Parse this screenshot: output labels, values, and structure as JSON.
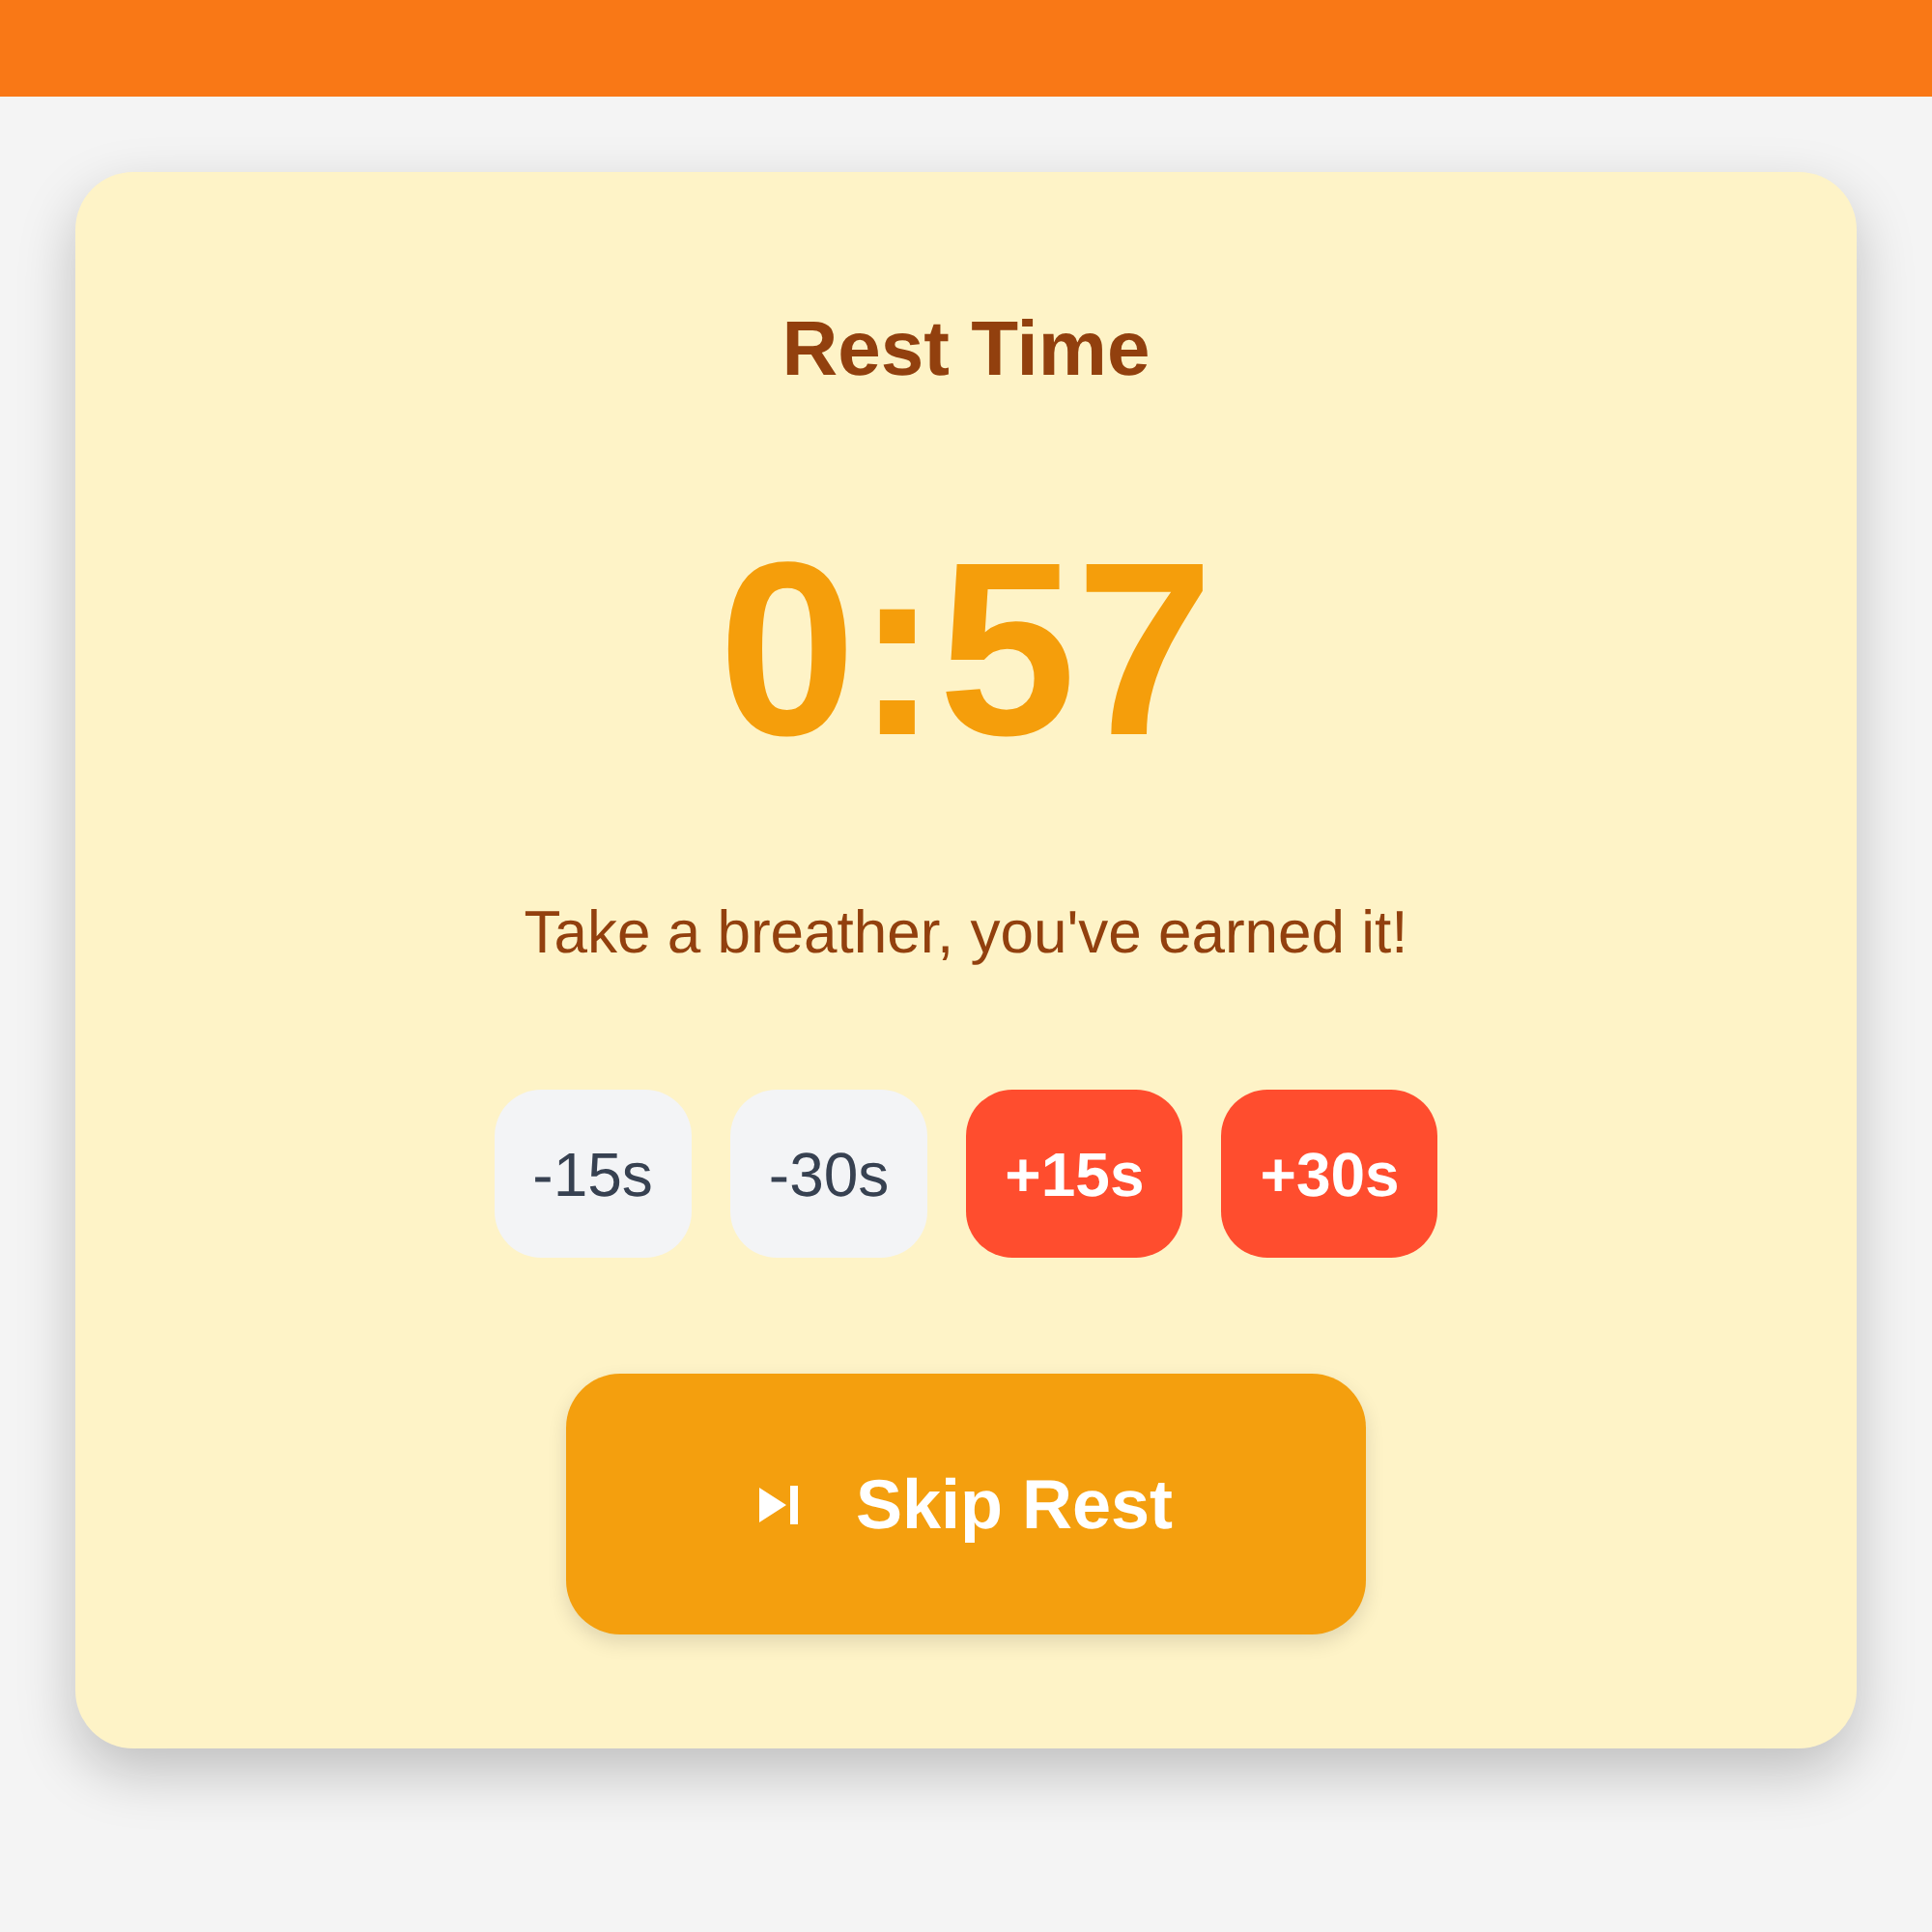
{
  "title": "Rest Time",
  "timer": "0:57",
  "message": "Take a breather, you've earned it!",
  "adjust_buttons": [
    {
      "label": "-15s",
      "kind": "decrease"
    },
    {
      "label": "-30s",
      "kind": "decrease"
    },
    {
      "label": "+15s",
      "kind": "increase"
    },
    {
      "label": "+30s",
      "kind": "increase"
    }
  ],
  "skip_button": {
    "label": "Skip Rest"
  }
}
